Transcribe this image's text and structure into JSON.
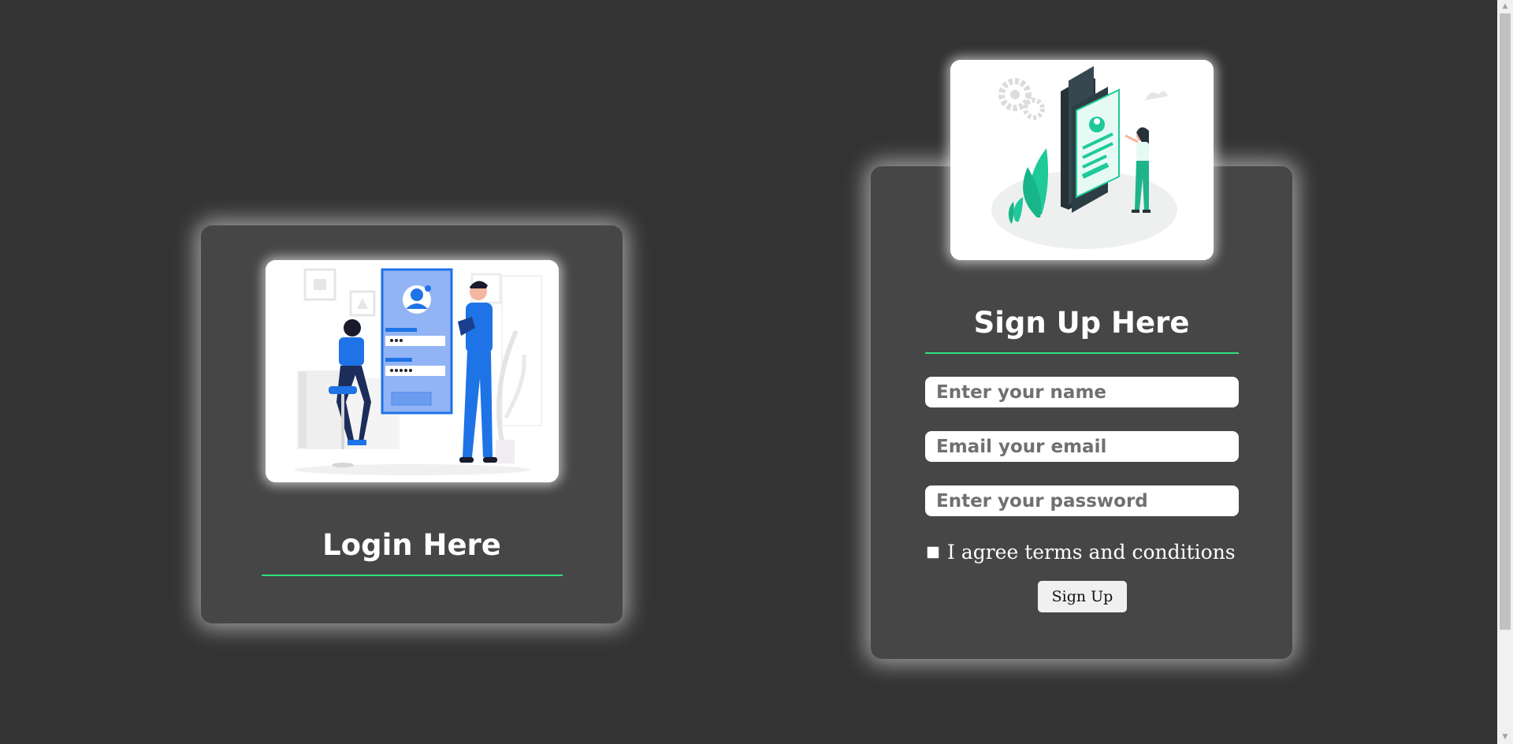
{
  "login": {
    "illustration_icon": "login-illustration",
    "heading": "Login Here",
    "accent_color": "#2ee07c"
  },
  "signup": {
    "illustration_icon": "signup-illustration",
    "heading": "Sign Up Here",
    "name_placeholder": "Enter your name",
    "email_placeholder": "Email your email",
    "password_placeholder": "Enter your password",
    "terms_label": "I agree terms and conditions",
    "submit_label": "Sign Up"
  },
  "colors": {
    "background": "#333333",
    "card": "#464646",
    "accent": "#2ee07c"
  }
}
